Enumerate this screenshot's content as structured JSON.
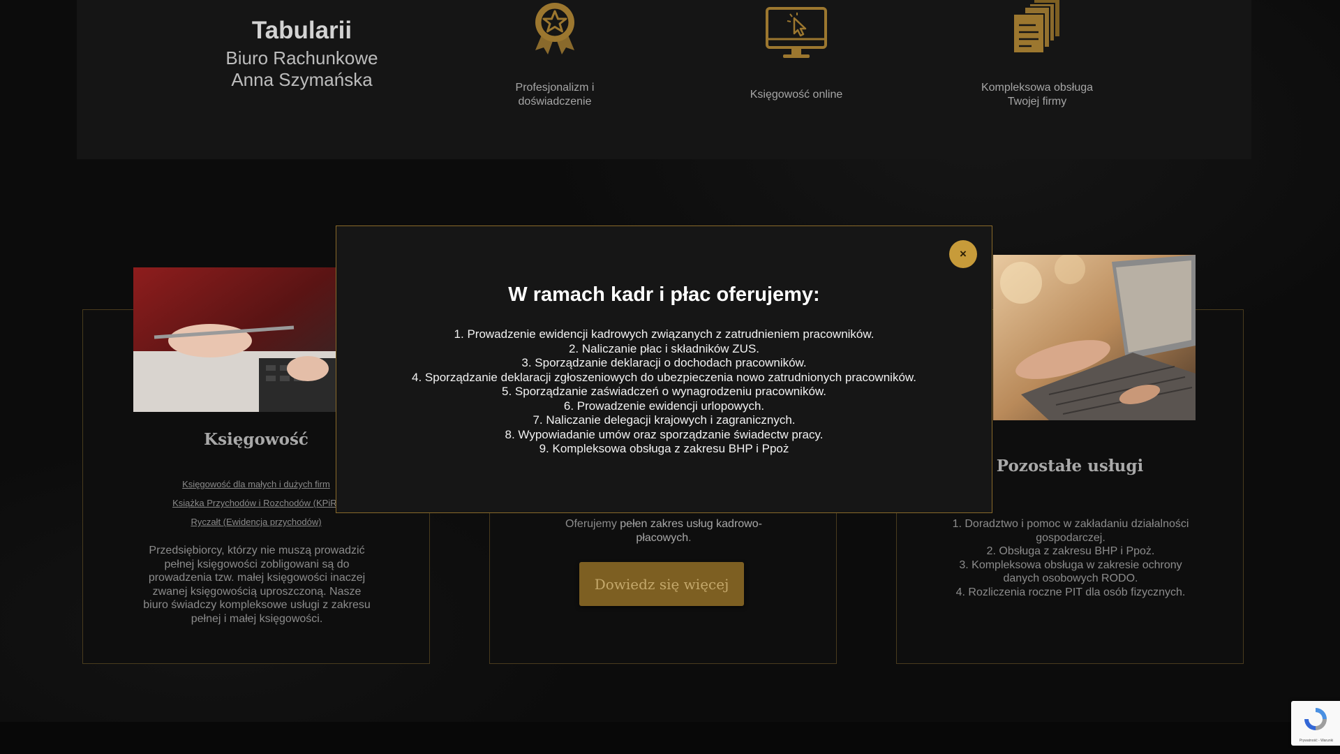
{
  "brand": {
    "title": "Tabularii",
    "subtitle_line1": "Biuro Rachunkowe",
    "subtitle_line2": "Anna Szymańska"
  },
  "features": [
    {
      "icon": "award-medal-icon",
      "label_line1": "Profesjonalizm i",
      "label_line2": "doświadczenie"
    },
    {
      "icon": "computer-monitor-icon",
      "label_line1": "Księgowość online",
      "label_line2": ""
    },
    {
      "icon": "documents-stack-icon",
      "label_line1": "Kompleksowa obsługa",
      "label_line2": "Twojej firmy"
    }
  ],
  "cards": {
    "accounting": {
      "title": "Księgowość",
      "links": [
        "Księgowość dla małych i dużych firm",
        "Książka Przychodów i Rozchodów (KPiR)",
        "Ryczałt (Ewidencja przychodów)"
      ],
      "text": "Przedsiębiorcy, którzy nie muszą prowadzić pełnej księgowości zobligowani są do prowadzenia tzw. małej księgowości inaczej zwanej księgowością uproszczoną. Nasze biuro świadczy kompleksowe usługi z zakresu pełnej i małej księgowości."
    },
    "hr": {
      "text_prefix": "Oferujemy ",
      "text_strong": "pełen zakres usług kadrowo-płacowych",
      "text_suffix": ".",
      "cta_label": "Dowiedz się więcej"
    },
    "other": {
      "title": "Pozostałe usługi",
      "items": [
        "1. Doradztwo i pomoc w zakładaniu działalności gospodarczej.",
        "2. Obsługa z zakresu BHP i Ppoż.",
        "3. Kompleksowa obsługa w zakresie ochrony danych osobowych RODO.",
        "4. Rozliczenia roczne PIT dla osób fizycznych."
      ]
    }
  },
  "modal": {
    "close_label": "×",
    "title": "W ramach kadr i płac oferujemy:",
    "items": [
      "1. Prowadzenie ewidencji kadrowych związanych z zatrudnieniem pracowników.",
      "2. Naliczanie płac i składników ZUS.",
      "3. Sporządzanie deklaracji o dochodach pracowników.",
      "4. Sporządzanie deklaracji zgłoszeniowych do ubezpieczenia nowo zatrudnionych pracowników.",
      "5. Sporządzanie zaświadczeń o wynagrodzeniu pracowników.",
      "6. Prowadzenie ewidencji urlopowych.",
      "7. Naliczanie delegacji krajowych i zagranicznych.",
      "8. Wypowiadanie umów oraz sporządzanie świadectw pracy.",
      "9. Kompleksowa obsługa z zakresu BHP i Ppoż"
    ]
  },
  "recaptcha": {
    "text": "Prywatność - Warunki"
  },
  "colors": {
    "accent_gold": "#c79b3a",
    "button_gold": "#7d5f22",
    "background": "#0c0c0c"
  }
}
